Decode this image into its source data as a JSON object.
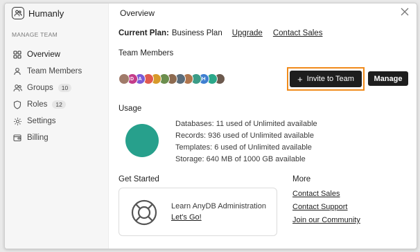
{
  "brand": {
    "name": "Humanly"
  },
  "sidebar": {
    "section_label": "MANAGE TEAM",
    "items": [
      {
        "label": "Overview",
        "icon": "grid-icon",
        "badge": null,
        "active": true
      },
      {
        "label": "Team Members",
        "icon": "user-icon",
        "badge": null,
        "active": false
      },
      {
        "label": "Groups",
        "icon": "users-icon",
        "badge": "10",
        "active": false
      },
      {
        "label": "Roles",
        "icon": "shield-icon",
        "badge": "12",
        "active": false
      },
      {
        "label": "Settings",
        "icon": "gear-icon",
        "badge": null,
        "active": false
      },
      {
        "label": "Billing",
        "icon": "wallet-icon",
        "badge": null,
        "active": false
      }
    ]
  },
  "main": {
    "title": "Overview",
    "plan": {
      "label": "Current Plan:",
      "value": "Business Plan",
      "upgrade": "Upgrade",
      "contact_sales": "Contact Sales"
    },
    "team": {
      "heading": "Team Members",
      "avatars": [
        {
          "letter": "",
          "color": "#a07b6a"
        },
        {
          "letter": "D",
          "color": "#c43c8a"
        },
        {
          "letter": "A",
          "color": "#7b5cd6"
        },
        {
          "letter": "",
          "color": "#e05a4f"
        },
        {
          "letter": "",
          "color": "#d79a2a"
        },
        {
          "letter": "",
          "color": "#6b8e4e"
        },
        {
          "letter": "",
          "color": "#8d6b50"
        },
        {
          "letter": "",
          "color": "#5a6d7c"
        },
        {
          "letter": "",
          "color": "#b0764e"
        },
        {
          "letter": "",
          "color": "#3b9c87"
        },
        {
          "letter": "H",
          "color": "#3f7fd1"
        },
        {
          "letter": "",
          "color": "#2ba88a"
        },
        {
          "letter": "",
          "color": "#6c5a4e"
        }
      ],
      "invite_label": "Invite to Team",
      "manage_label": "Manage"
    },
    "usage": {
      "heading": "Usage",
      "lines": [
        "Databases: 11 used of Unlimited available",
        "Records: 936 used of Unlimited available",
        "Templates: 6 used of Unlimited available",
        "Storage: 640 MB of 1000 GB available"
      ],
      "chart_color": "#27a08c"
    },
    "get_started": {
      "heading": "Get Started",
      "card_title": "Learn AnyDB Administration",
      "card_link": "Let's Go!"
    },
    "more": {
      "heading": "More",
      "links": [
        "Contact Sales",
        "Contact Support",
        "Join our Community"
      ]
    }
  },
  "accent": "#f08a1a"
}
